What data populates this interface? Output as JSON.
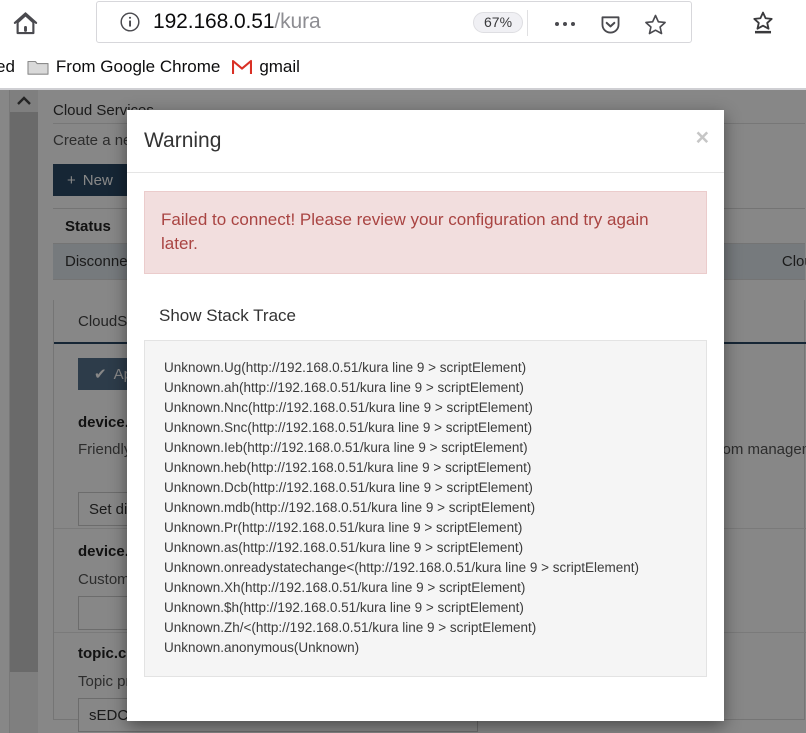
{
  "browser": {
    "home_icon": "home-icon",
    "identity_icon": "info-circle-icon",
    "url_host": "192.168.0.51",
    "url_path": "/kura",
    "zoom_level": "67%",
    "menu_icon": "ellipsis-icon",
    "pocket_icon": "pocket-shield-icon",
    "bookmark_icon": "star-icon",
    "extension_icon": "save-to-pocket-icon",
    "bookmarks": [
      {
        "label": "ed",
        "icon": ""
      },
      {
        "label": "From Google Chrome",
        "icon": "folder-icon"
      },
      {
        "label": "gmail",
        "icon": "gmail-m-icon"
      }
    ]
  },
  "page": {
    "title": "Cloud Services",
    "subtitle": "Create a new cloud connection or manage the existing connections",
    "new_button": "New",
    "plus_icon": "plus-icon",
    "table": {
      "headers": [
        "Status"
      ],
      "rows": [
        {
          "status": "Disconnected",
          "name": "CloudService-"
        }
      ]
    },
    "tab_active": "CloudService",
    "apply_button": "Apply",
    "check_icon": "check-icon",
    "fields": [
      {
        "label": "device.display-name",
        "description": "Friendly name for the device (e.g. Raspberry Pi, etc.) to be shown in the linux hostname or a custom management server",
        "value": "Set display name"
      },
      {
        "label": "device.custom-name",
        "description": "Custom name for the device",
        "value": ""
      },
      {
        "label": "topic.context.account-name",
        "description": "Topic prefix",
        "value": "sEDC"
      }
    ]
  },
  "dialog": {
    "title": "Warning",
    "close_icon": "close-icon",
    "alert_message": "Failed to connect! Please review your configuration and try again later.",
    "stack_trace_heading": "Show Stack Trace",
    "stack_trace": [
      "Unknown.Ug(http://192.168.0.51/kura line 9 > scriptElement)",
      "Unknown.ah(http://192.168.0.51/kura line 9 > scriptElement)",
      "Unknown.Nnc(http://192.168.0.51/kura line 9 > scriptElement)",
      "Unknown.Snc(http://192.168.0.51/kura line 9 > scriptElement)",
      "Unknown.Ieb(http://192.168.0.51/kura line 9 > scriptElement)",
      "Unknown.heb(http://192.168.0.51/kura line 9 > scriptElement)",
      "Unknown.Dcb(http://192.168.0.51/kura line 9 > scriptElement)",
      "Unknown.mdb(http://192.168.0.51/kura line 9 > scriptElement)",
      "Unknown.Pr(http://192.168.0.51/kura line 9 > scriptElement)",
      "Unknown.as(http://192.168.0.51/kura line 9 > scriptElement)",
      "Unknown.onreadystatechange<(http://192.168.0.51/kura line 9 > scriptElement)",
      "Unknown.Xh(http://192.168.0.51/kura line 9 > scriptElement)",
      "Unknown.$h(http://192.168.0.51/kura line 9 > scriptElement)",
      "Unknown.Zh/<(http://192.168.0.51/kura line 9 > scriptElement)",
      "Unknown.anonymous(Unknown)"
    ]
  },
  "colors": {
    "alert_bg": "#f2dede",
    "alert_text": "#a94442",
    "primary_button": "#2b4964",
    "accent_underline": "#2b4964"
  }
}
